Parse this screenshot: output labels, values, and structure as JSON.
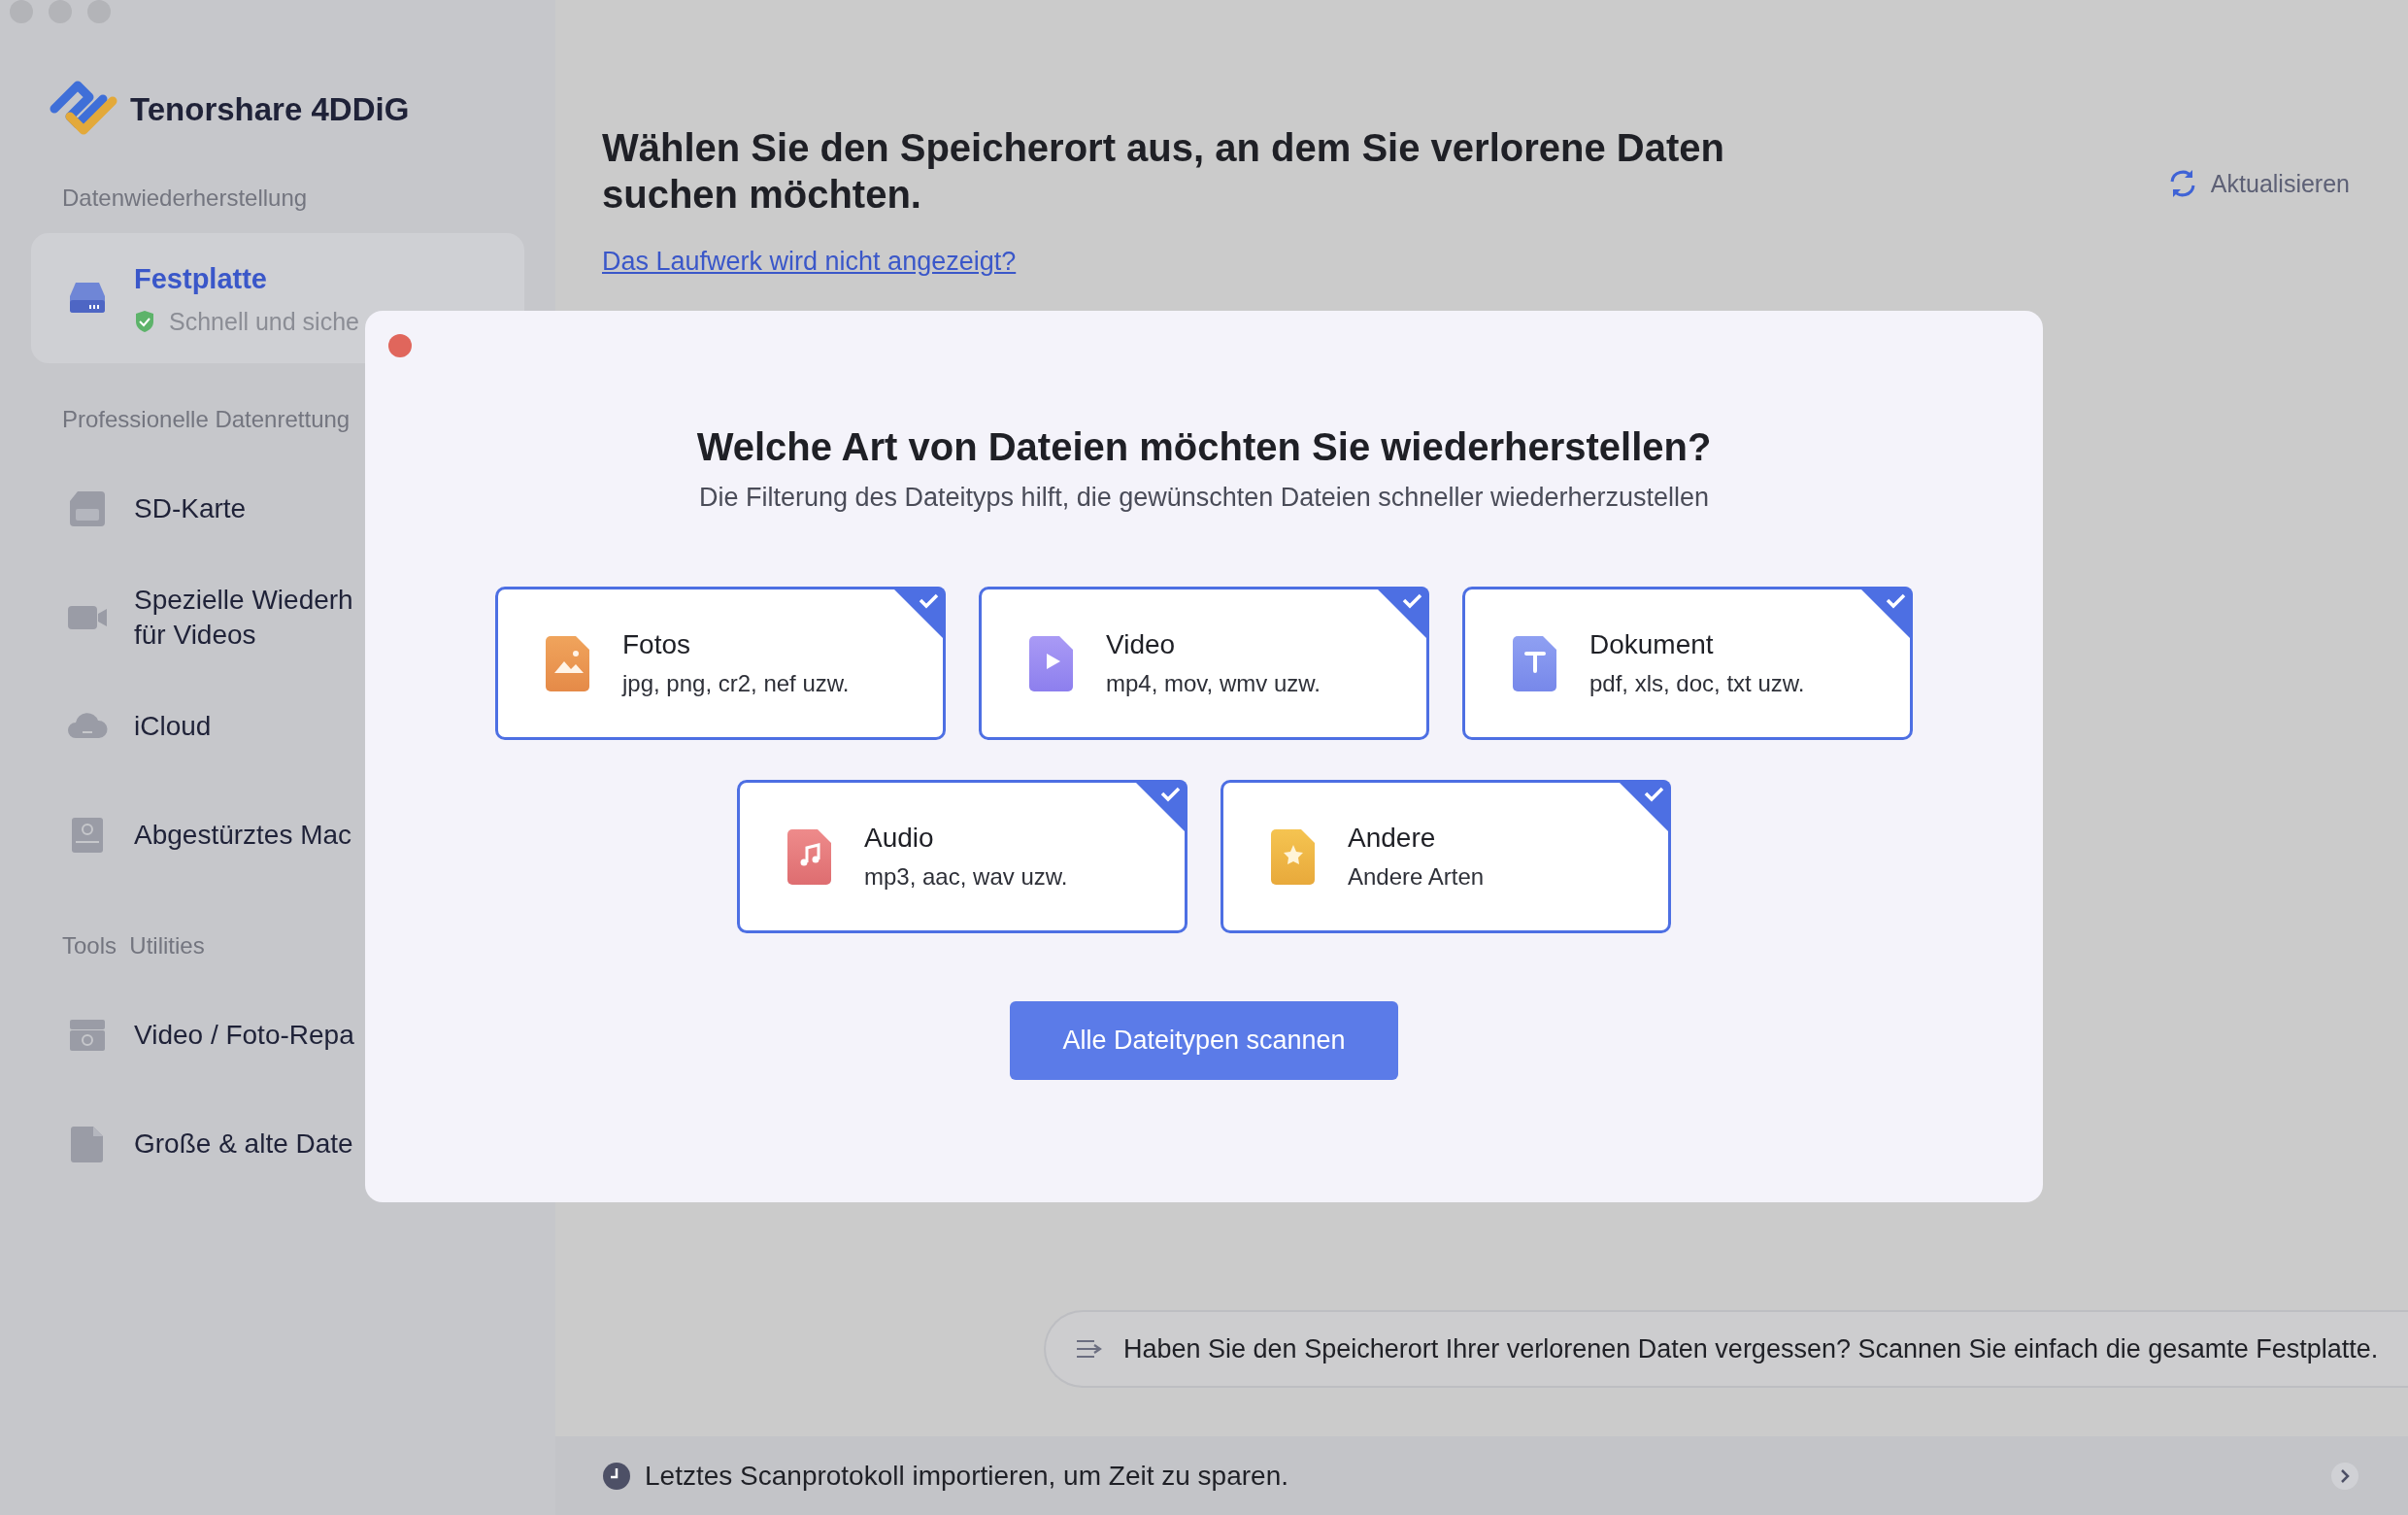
{
  "sidebar": {
    "app_name": "Tenorshare 4DDiG",
    "sections": [
      {
        "heading": "Datenwiederherstellung",
        "items": [
          {
            "kind": "drive",
            "label": "Festplatte",
            "subtitle": "Schnell und siche",
            "selected": true
          }
        ]
      },
      {
        "heading": "Professionelle Datenrettung",
        "items": [
          {
            "kind": "sd",
            "label": "SD-Karte",
            "selected": false
          },
          {
            "kind": "camera",
            "label": "Spezielle Wiederh\nfür Videos",
            "selected": false
          },
          {
            "kind": "cloud",
            "label": "iCloud",
            "selected": false
          },
          {
            "kind": "mac",
            "label": "Abgestürztes Mac",
            "selected": false
          }
        ]
      },
      {
        "heading": "Tools  Utilities",
        "items": [
          {
            "kind": "repair",
            "label": "Video / Foto-Repa",
            "selected": false
          },
          {
            "kind": "file",
            "label": "Große & alte Date",
            "selected": false
          }
        ]
      }
    ]
  },
  "main": {
    "title": "Wählen Sie den Speicherort aus, an dem Sie verlorene Daten suchen möchten.",
    "link": "Das Laufwerk wird nicht angezeigt?",
    "refresh": "Aktualisieren",
    "hint": "Haben Sie den Speicherort Ihrer verlorenen Daten vergessen? Scannen Sie einfach die gesamte Festplatte.",
    "footer": "Letztes Scanprotokoll importieren, um Zeit zu sparen."
  },
  "modal": {
    "title": "Welche Art von Dateien möchten Sie wiederherstellen?",
    "subtitle": "Die Filterung des Dateityps hilft, die gewünschten Dateien schneller wiederherzustellen",
    "file_types": [
      {
        "kind": "photo",
        "name": "Fotos",
        "formats": "jpg, png, cr2, nef uzw.",
        "selected": true
      },
      {
        "kind": "video",
        "name": "Video",
        "formats": "mp4, mov, wmv uzw.",
        "selected": true
      },
      {
        "kind": "document",
        "name": "Dokument",
        "formats": "pdf, xls, doc, txt uzw.",
        "selected": true
      },
      {
        "kind": "audio",
        "name": "Audio",
        "formats": "mp3, aac, wav uzw.",
        "selected": true
      },
      {
        "kind": "other",
        "name": "Andere",
        "formats": "Andere Arten",
        "selected": true
      }
    ],
    "button": "Alle Dateitypen scannen"
  }
}
